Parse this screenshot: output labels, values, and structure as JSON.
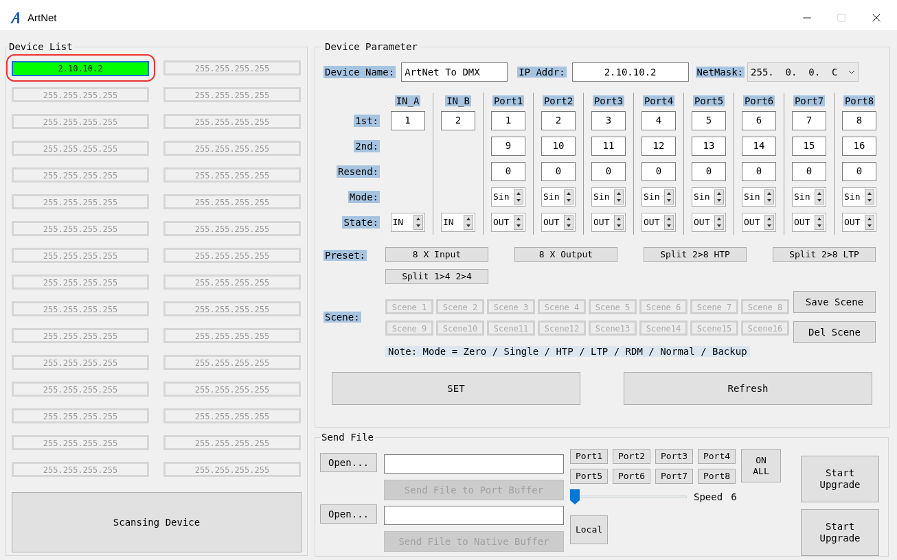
{
  "window": {
    "title": "ArtNet"
  },
  "device_list": {
    "title": "Device List",
    "devices": [
      {
        "address": "2.10.10.2",
        "selected": true
      },
      {
        "address": "255.255.255.255",
        "selected": false
      },
      {
        "address": "255.255.255.255",
        "selected": false
      },
      {
        "address": "255.255.255.255",
        "selected": false
      },
      {
        "address": "255.255.255.255",
        "selected": false
      },
      {
        "address": "255.255.255.255",
        "selected": false
      },
      {
        "address": "255.255.255.255",
        "selected": false
      },
      {
        "address": "255.255.255.255",
        "selected": false
      },
      {
        "address": "255.255.255.255",
        "selected": false
      },
      {
        "address": "255.255.255.255",
        "selected": false
      },
      {
        "address": "255.255.255.255",
        "selected": false
      },
      {
        "address": "255.255.255.255",
        "selected": false
      },
      {
        "address": "255.255.255.255",
        "selected": false
      },
      {
        "address": "255.255.255.255",
        "selected": false
      },
      {
        "address": "255.255.255.255",
        "selected": false
      },
      {
        "address": "255.255.255.255",
        "selected": false
      },
      {
        "address": "255.255.255.255",
        "selected": false
      },
      {
        "address": "255.255.255.255",
        "selected": false
      },
      {
        "address": "255.255.255.255",
        "selected": false
      },
      {
        "address": "255.255.255.255",
        "selected": false
      },
      {
        "address": "255.255.255.255",
        "selected": false
      },
      {
        "address": "255.255.255.255",
        "selected": false
      },
      {
        "address": "255.255.255.255",
        "selected": false
      },
      {
        "address": "255.255.255.255",
        "selected": false
      },
      {
        "address": "255.255.255.255",
        "selected": false
      },
      {
        "address": "255.255.255.255",
        "selected": false
      },
      {
        "address": "255.255.255.255",
        "selected": false
      },
      {
        "address": "255.255.255.255",
        "selected": false
      },
      {
        "address": "255.255.255.255",
        "selected": false
      },
      {
        "address": "255.255.255.255",
        "selected": false
      },
      {
        "address": "255.255.255.255",
        "selected": false
      },
      {
        "address": "255.255.255.255",
        "selected": false
      }
    ],
    "scan_button": "Scansing Device"
  },
  "device_parameter": {
    "title": "Device Parameter",
    "device_name": {
      "label": "Device Name:",
      "value": "ArtNet To DMX"
    },
    "ip_addr": {
      "label": "IP Addr:",
      "value": "2.10.10.2"
    },
    "netmask": {
      "label": "NetMask:",
      "value": "255.  0.  0.  C"
    },
    "row_labels": [
      "1st:",
      "2nd:",
      "Resend:",
      "Mode:",
      "State:"
    ],
    "ports": [
      {
        "kind": "input",
        "name": "IN_A",
        "first": "1",
        "state": "IN"
      },
      {
        "kind": "input",
        "name": "IN_B",
        "first": "2",
        "state": "IN"
      },
      {
        "kind": "output",
        "name": "Port1",
        "first": "1",
        "second": "9",
        "resend": "0",
        "mode": "Sin",
        "state": "OUT"
      },
      {
        "kind": "output",
        "name": "Port2",
        "first": "2",
        "second": "10",
        "resend": "0",
        "mode": "Sin",
        "state": "OUT"
      },
      {
        "kind": "output",
        "name": "Port3",
        "first": "3",
        "second": "11",
        "resend": "0",
        "mode": "Sin",
        "state": "OUT"
      },
      {
        "kind": "output",
        "name": "Port4",
        "first": "4",
        "second": "12",
        "resend": "0",
        "mode": "Sin",
        "state": "OUT"
      },
      {
        "kind": "output",
        "name": "Port5",
        "first": "5",
        "second": "13",
        "resend": "0",
        "mode": "Sin",
        "state": "OUT"
      },
      {
        "kind": "output",
        "name": "Port6",
        "first": "6",
        "second": "14",
        "resend": "0",
        "mode": "Sin",
        "state": "OUT"
      },
      {
        "kind": "output",
        "name": "Port7",
        "first": "7",
        "second": "15",
        "resend": "0",
        "mode": "Sin",
        "state": "OUT"
      },
      {
        "kind": "output",
        "name": "Port8",
        "first": "8",
        "second": "16",
        "resend": "0",
        "mode": "Sin",
        "state": "OUT"
      }
    ],
    "preset": {
      "label": "Preset:",
      "buttons": [
        "8 X Input",
        "8 X Output",
        "Split 2>8 HTP",
        "Split 2>8 LTP",
        "Split 1>4 2>4"
      ]
    },
    "scene": {
      "label": "Scene:",
      "buttons": [
        {
          "label": "Scene 1",
          "disabled": true
        },
        {
          "label": "Scene 2",
          "disabled": true
        },
        {
          "label": "Scene 3",
          "disabled": true
        },
        {
          "label": "Scene 4",
          "disabled": true
        },
        {
          "label": "Scene 5",
          "disabled": true
        },
        {
          "label": "Scene 6",
          "disabled": true
        },
        {
          "label": "Scene 7",
          "disabled": true
        },
        {
          "label": "Scene 8",
          "disabled": true
        },
        {
          "label": "Scene 9",
          "disabled": true
        },
        {
          "label": "Scene10",
          "disabled": true
        },
        {
          "label": "Scene11",
          "disabled": true
        },
        {
          "label": "Scene12",
          "disabled": true
        },
        {
          "label": "Scene13",
          "disabled": true
        },
        {
          "label": "Scene14",
          "disabled": true
        },
        {
          "label": "Scene15",
          "disabled": true
        },
        {
          "label": "Scene16",
          "disabled": true
        }
      ],
      "save_button": "Save Scene",
      "delete_button": "Del Scene"
    },
    "note": "Note: Mode = Zero / Single / HTP / LTP / RDM / Normal / Backup",
    "set_button": "SET",
    "refresh_button": "Refresh"
  },
  "send_file": {
    "title": "Send File",
    "rows": [
      {
        "open_button": "Open...",
        "send_button": "Send File to Port Buffer",
        "send_disabled": true
      },
      {
        "open_button": "Open...",
        "send_button": "Send File to Native Buffer",
        "send_disabled": true
      }
    ],
    "ports": [
      "Port1",
      "Port2",
      "Port3",
      "Port4",
      "Port5",
      "Port6",
      "Port7",
      "Port8"
    ],
    "on_all_button": "ON ALL",
    "speed": {
      "label": "Speed",
      "value": "6",
      "level": 0
    },
    "local_button": "Local",
    "upgrade_buttons": [
      "Start Upgrade",
      "Start Upgrade"
    ]
  }
}
